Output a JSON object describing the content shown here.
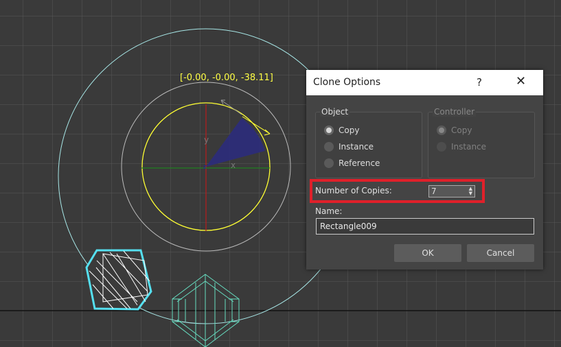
{
  "viewport": {
    "coordinate_readout": "[-0.00, -0.00, -38.11]",
    "axis_labels": {
      "x": "x",
      "y": "y",
      "z": "z"
    },
    "colors": {
      "background": "#3a3a3a",
      "grid": "#555555",
      "gizmo": "#ffff33",
      "path": "#a8e8e8",
      "clone": "#66ddc0"
    }
  },
  "dialog": {
    "title": "Clone Options",
    "help_label": "?",
    "close_icon": "close-icon",
    "object_group": {
      "label": "Object",
      "options": [
        {
          "label": "Copy",
          "selected": true
        },
        {
          "label": "Instance",
          "selected": false
        },
        {
          "label": "Reference",
          "selected": false
        }
      ]
    },
    "controller_group": {
      "label": "Controller",
      "disabled": true,
      "options": [
        {
          "label": "Copy",
          "selected": true
        },
        {
          "label": "Instance",
          "selected": false
        }
      ]
    },
    "copies_label": "Number of Copies:",
    "copies_value": "7",
    "name_label": "Name:",
    "name_value": "Rectangle009",
    "ok_label": "OK",
    "cancel_label": "Cancel",
    "highlight_color": "#e0202a"
  }
}
